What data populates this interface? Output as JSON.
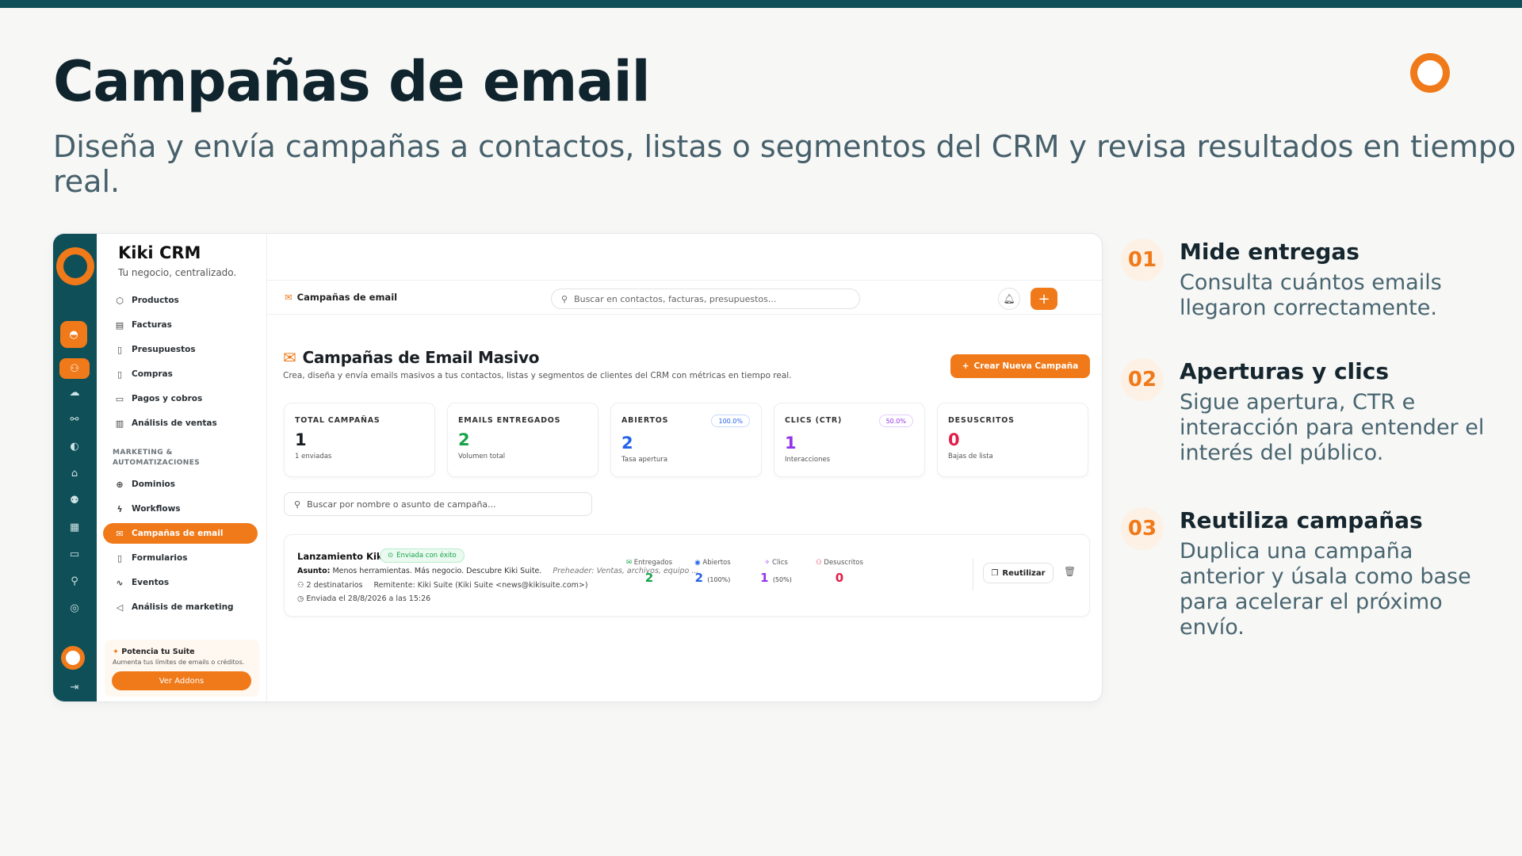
{
  "slide": {
    "title": "Campañas de email",
    "subtitle": "Diseña y envía campañas a contactos, listas o segmentos del CRM y revisa resultados en tiempo real."
  },
  "colors": {
    "accent": "#f07a1a",
    "rail": "#0f4f57",
    "success": "#16a34a",
    "blue": "#2563eb",
    "purple": "#9333ea",
    "red": "#e11d48"
  },
  "app": {
    "name": "Kiki CRM",
    "tagline": "Tu negocio, centralizado.",
    "nav": [
      {
        "label": "Productos",
        "icon": "box-icon"
      },
      {
        "label": "Facturas",
        "icon": "invoice-icon"
      },
      {
        "label": "Presupuestos",
        "icon": "document-icon"
      },
      {
        "label": "Compras",
        "icon": "cart-icon"
      },
      {
        "label": "Pagos y cobros",
        "icon": "card-icon"
      },
      {
        "label": "Análisis de ventas",
        "icon": "chart-icon"
      }
    ],
    "section_label": "MARKETING & AUTOMATIZACIONES",
    "nav2": [
      {
        "label": "Dominios",
        "icon": "globe-icon"
      },
      {
        "label": "Workflows",
        "icon": "bolt-icon"
      },
      {
        "label": "Campañas de email",
        "icon": "mail-icon",
        "active": true
      },
      {
        "label": "Formularios",
        "icon": "form-icon"
      },
      {
        "label": "Eventos",
        "icon": "pulse-icon"
      },
      {
        "label": "Análisis de marketing",
        "icon": "megaphone-icon"
      }
    ],
    "upsell": {
      "title": "Potencia tu Suite",
      "desc": "Aumenta tus límites de emails o créditos.",
      "button": "Ver Addons"
    },
    "header": {
      "breadcrumb": "Campañas de email",
      "search_placeholder": "Buscar en contactos, facturas, presupuestos..."
    },
    "main": {
      "title": "Campañas de Email Masivo",
      "description": "Crea, diseña y envía emails masivos a tus contactos, listas y segmentos de clientes del CRM con métricas en tiempo real.",
      "create_button": "Crear Nueva Campaña",
      "filter_placeholder": "Buscar por nombre o asunto de campaña..."
    },
    "stats": [
      {
        "label": "TOTAL CAMPAÑAS",
        "value": "1",
        "sub": "1 enviadas",
        "color": "#1a1f24"
      },
      {
        "label": "EMAILS ENTREGADOS",
        "value": "2",
        "sub": "Volumen total",
        "color": "#16a34a"
      },
      {
        "label": "ABIERTOS",
        "value": "2",
        "sub": "Tasa apertura",
        "pill": "100.0%",
        "color": "#2563eb"
      },
      {
        "label": "CLICS (CTR)",
        "value": "1",
        "sub": "Interacciones",
        "pill": "50.0%",
        "color": "#9333ea"
      },
      {
        "label": "DESUSCRITOS",
        "value": "0",
        "sub": "Bajas de lista",
        "color": "#e11d48"
      }
    ],
    "campaign": {
      "name": "Lanzamiento Kiki",
      "status": "Enviada con éxito",
      "asunto_label": "Asunto:",
      "asunto": "Menos herramientas. Más negocio. Descubre Kiki Suite.",
      "preheader": "Preheader: Ventas, archivos, equipo ...",
      "recipients": "2 destinatarios",
      "sender": "Remitente: Kiki Suite (Kiki Suite <news@kikisuite.com>)",
      "sent_at": "Enviada el 28/8/2026 a las 15:26",
      "metrics": [
        {
          "label": "Entregados",
          "value": "2",
          "extra": "",
          "color": "#16a34a"
        },
        {
          "label": "Abiertos",
          "value": "2",
          "extra": "(100%)",
          "color": "#2563eb"
        },
        {
          "label": "Clics",
          "value": "1",
          "extra": "(50%)",
          "color": "#9333ea"
        },
        {
          "label": "Desuscritos",
          "value": "0",
          "extra": "",
          "color": "#e11d48"
        }
      ],
      "reuse_button": "Reutilizar"
    }
  },
  "features": [
    {
      "num": "01",
      "title": "Mide entregas",
      "desc": "Consulta cuántos emails llegaron correctamente."
    },
    {
      "num": "02",
      "title": "Aperturas y clics",
      "desc": "Sigue apertura, CTR e interacción para entender el interés del público."
    },
    {
      "num": "03",
      "title": "Reutiliza campañas",
      "desc": "Duplica una campaña anterior y úsala como base para acelerar el próximo envío."
    }
  ]
}
